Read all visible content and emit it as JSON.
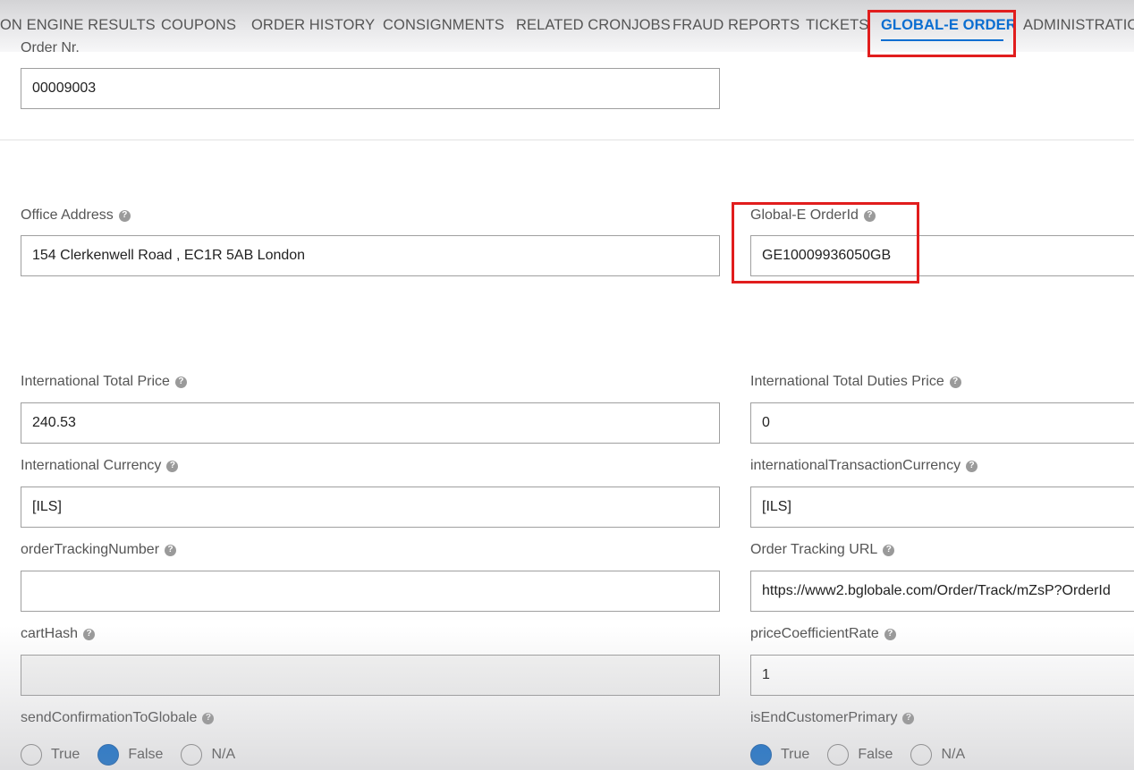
{
  "tabs": [
    {
      "label": "ON ENGINE RESULTS"
    },
    {
      "label": "COUPONS"
    },
    {
      "label": "ORDER HISTORY"
    },
    {
      "label": "CONSIGNMENTS"
    },
    {
      "label": "RELATED CRONJOBS"
    },
    {
      "label": "FRAUD REPORTS"
    },
    {
      "label": "TICKETS"
    },
    {
      "label": "GLOBAL-E ORDER",
      "active": true
    },
    {
      "label": "ADMINISTRATION"
    }
  ],
  "order_nr": {
    "label": "Order Nr.",
    "value": "00009003"
  },
  "office_address": {
    "label": "Office Address",
    "value": "154 Clerkenwell Road , EC1R 5AB London"
  },
  "globale_order_id": {
    "label": "Global-E OrderId",
    "value": "GE10009936050GB"
  },
  "intl_total_price": {
    "label": "International Total Price",
    "value": "240.53"
  },
  "intl_total_duties": {
    "label": "International Total Duties Price",
    "value": "0"
  },
  "intl_currency": {
    "label": "International Currency",
    "value": "[ILS]"
  },
  "intl_tx_currency": {
    "label": "internationalTransactionCurrency",
    "value": "[ILS]"
  },
  "order_tracking_number": {
    "label": "orderTrackingNumber",
    "value": ""
  },
  "order_tracking_url": {
    "label": "Order Tracking URL",
    "value": "https://www2.bglobale.com/Order/Track/mZsP?OrderId"
  },
  "cart_hash": {
    "label": "cartHash",
    "value": ""
  },
  "price_coefficient_rate": {
    "label": "priceCoefficientRate",
    "value": "1"
  },
  "send_confirmation": {
    "label": "sendConfirmationToGlobale",
    "options": [
      "True",
      "False",
      "N/A"
    ],
    "selected": "False"
  },
  "is_end_customer_primary": {
    "label": "isEndCustomerPrimary",
    "options": [
      "True",
      "False",
      "N/A"
    ],
    "selected": "True"
  },
  "colors": {
    "accent": "#0a6ed1",
    "highlight": "#e11d1d"
  },
  "icons": {
    "help": "question-circle-icon"
  }
}
